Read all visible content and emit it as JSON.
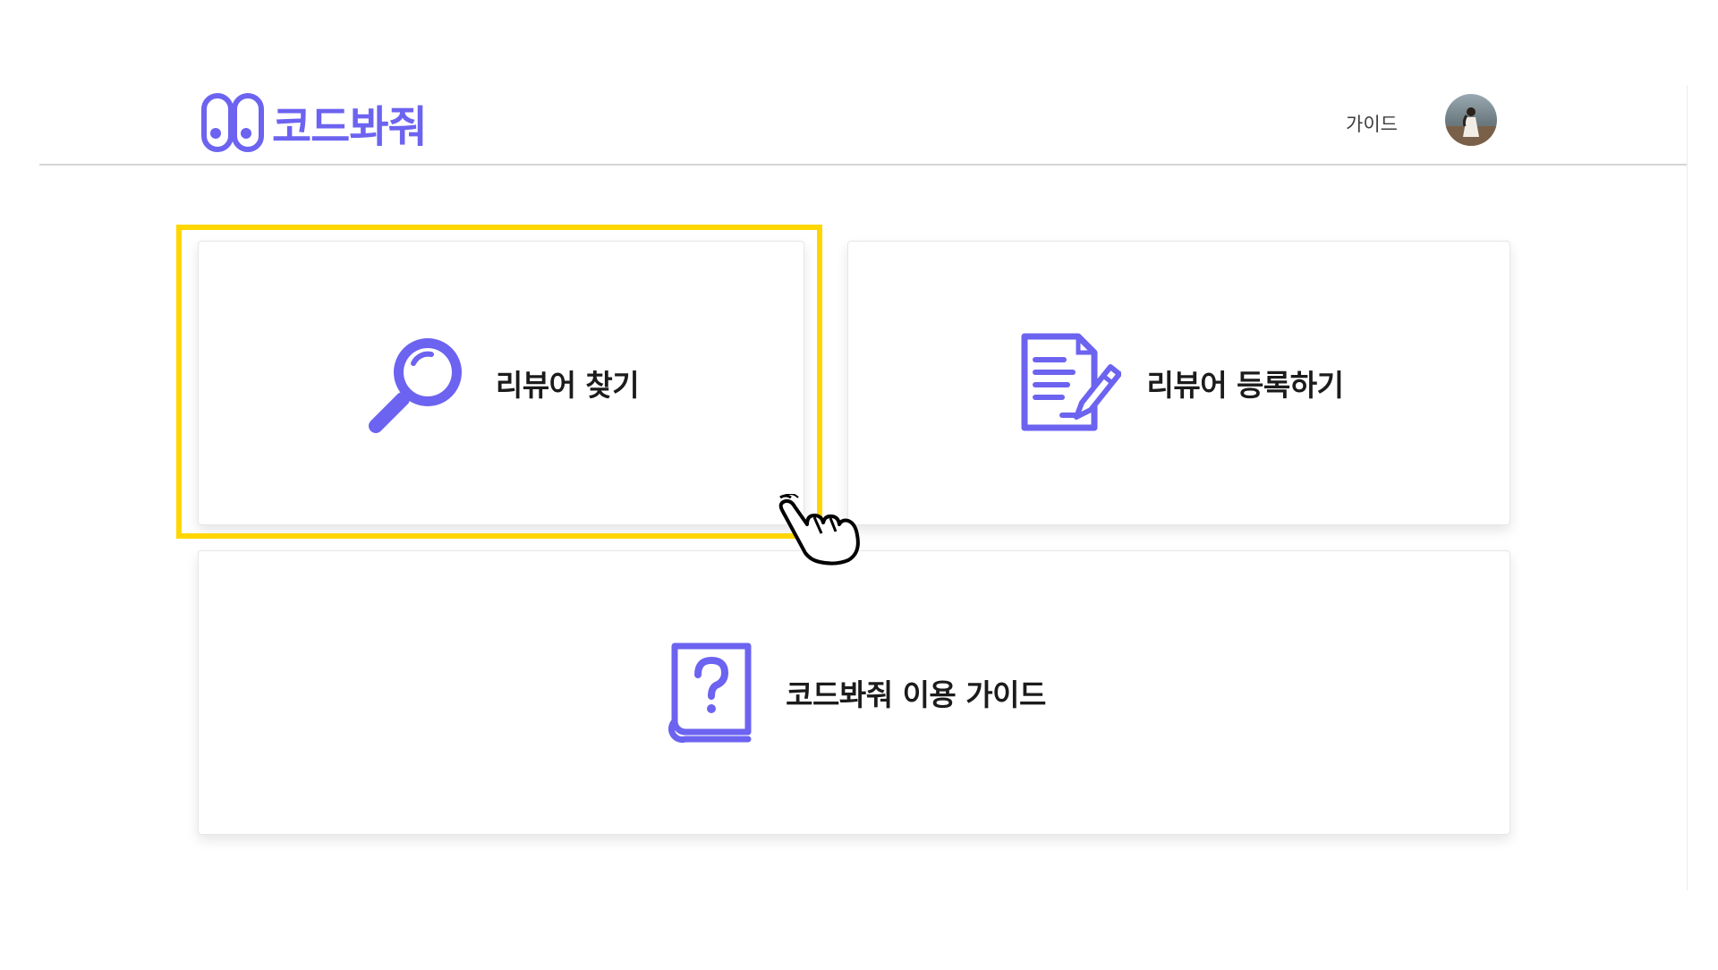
{
  "header": {
    "logo_text": "코드봐줘",
    "nav_guide_label": "가이드"
  },
  "cards": {
    "find_reviewer": {
      "label": "리뷰어 찾기",
      "icon": "search-icon"
    },
    "register_reviewer": {
      "label": "리뷰어 등록하기",
      "icon": "document-edit-icon"
    },
    "usage_guide": {
      "label": "코드봐줘 이용 가이드",
      "icon": "help-book-icon"
    }
  },
  "colors": {
    "accent": "#6c63f0",
    "highlight": "#ffd600"
  }
}
